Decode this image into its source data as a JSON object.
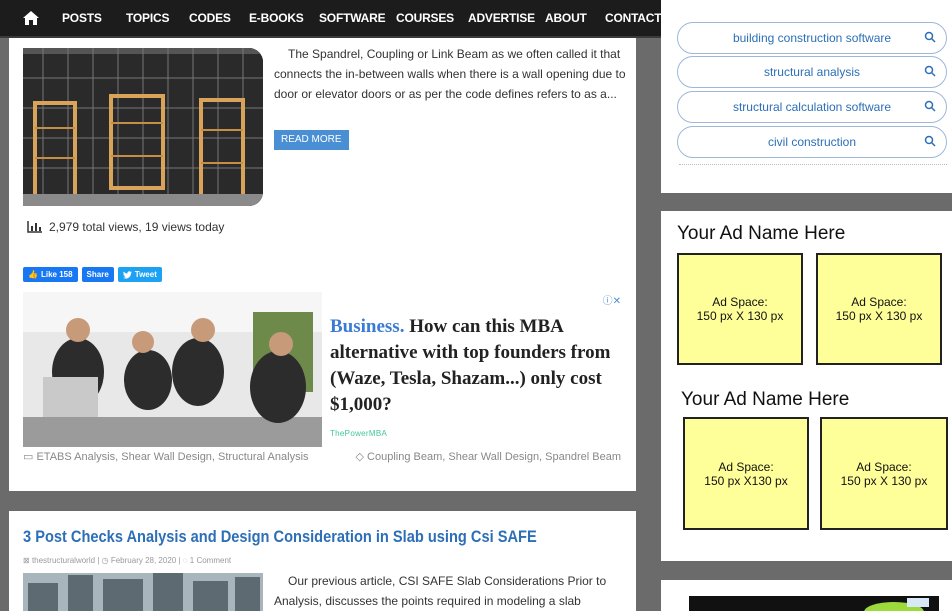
{
  "nav": {
    "items": [
      "POSTS",
      "TOPICS",
      "CODES",
      "E-BOOKS",
      "SOFTWARE",
      "COURSES",
      "ADVERTISE",
      "ABOUT",
      "CONTACT"
    ]
  },
  "post1": {
    "excerpt": "The Spandrel, Coupling or Link Beam as we often called it that connects the in-between walls when there is a wall opening due to door or elevator doors or as per the code defines refers to as a...",
    "read_more": "READ MORE",
    "views": "2,979 total views,  19 views today",
    "like_label": "Like 158",
    "share_label": "Share",
    "tweet_label": "Tweet",
    "categories": "ETABS Analysis, Shear Wall Design, Structural Analysis",
    "tags": "Coupling Beam, Shear Wall Design, Spandrel Beam"
  },
  "ad1": {
    "keyword": "Business.",
    "headline": "How can this MBA alternative with top founders from (Waze, Tesla, Shazam...) only cost $1,000?",
    "brand": "ThePowerMBA"
  },
  "post2": {
    "title": "3 Post Checks Analysis and Design Consideration in Slab using Csi SAFE",
    "author": "thestructuralworld",
    "date": "February 28, 2020",
    "comments": "1 Comment",
    "excerpt": "Our previous article, CSI SAFE Slab Considerations Prior to Analysis, discusses the points required in modeling a slab"
  },
  "sidebar": {
    "search_pills": [
      "building construction software",
      "structural analysis",
      "structural calculation software",
      "civil construction"
    ],
    "ad_title_1": "Your Ad Name Here",
    "ad_title_2": "Your Ad Name Here",
    "ad_boxes_row1": [
      "Ad Space:\n150 px X 130 px",
      "Ad Space:\n150 px X 130 px"
    ],
    "ad_boxes_row2": [
      "Ad Space:\n150 px X130 px",
      "Ad Space:\n150 px X 130 px"
    ]
  },
  "colors": {
    "accent": "#2c6fb7",
    "nav_bg": "#1c1c1c",
    "ad_yellow": "#ffff99",
    "facebook": "#1877f2",
    "twitter": "#1da1f2"
  }
}
